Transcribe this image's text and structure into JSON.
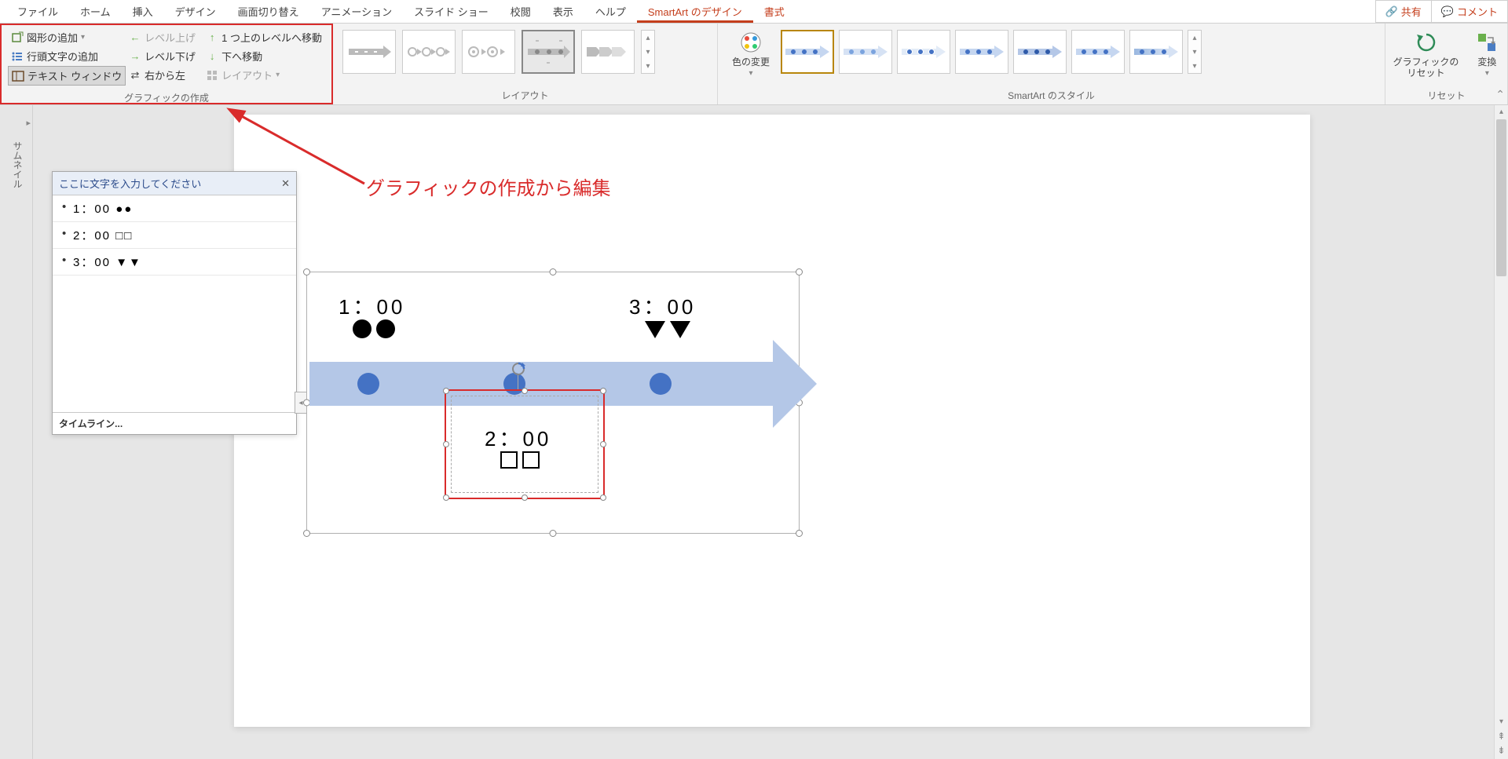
{
  "tabs": {
    "file": "ファイル",
    "home": "ホーム",
    "insert": "挿入",
    "design": "デザイン",
    "transitions": "画面切り替え",
    "animation": "アニメーション",
    "slideshow": "スライド ショー",
    "review": "校閲",
    "view": "表示",
    "help": "ヘルプ",
    "smartart_design": "SmartArt のデザイン",
    "format": "書式"
  },
  "topright": {
    "share": "共有",
    "comment": "コメント"
  },
  "ribbon": {
    "create": {
      "add_shape": "図形の追加",
      "add_bullet": "行頭文字の追加",
      "text_window": "テキスト ウィンドウ",
      "promote": "レベル上げ",
      "demote": "レベル下げ",
      "rtl": "右から左",
      "move_up": "1 つ上のレベルへ移動",
      "move_down": "下へ移動",
      "layout_menu": "レイアウト",
      "group_label": "グラフィックの作成"
    },
    "layouts_label": "レイアウト",
    "color_change": "色の変更",
    "styles_label": "SmartArt のスタイル",
    "reset_graphic": "グラフィックの\nリセット",
    "convert": "変換",
    "reset_label": "リセット"
  },
  "thumbnail_label": "サムネイル",
  "textpane": {
    "title": "ここに文字を入力してください",
    "items": [
      "1：00  ●●",
      "2：00  □□",
      "3：00  ▼▼"
    ],
    "footer": "タイムライン..."
  },
  "smartart": {
    "t1": "1：00",
    "t2": "2：00",
    "t3": "3：00"
  },
  "annotation": "グラフィックの作成から編集"
}
